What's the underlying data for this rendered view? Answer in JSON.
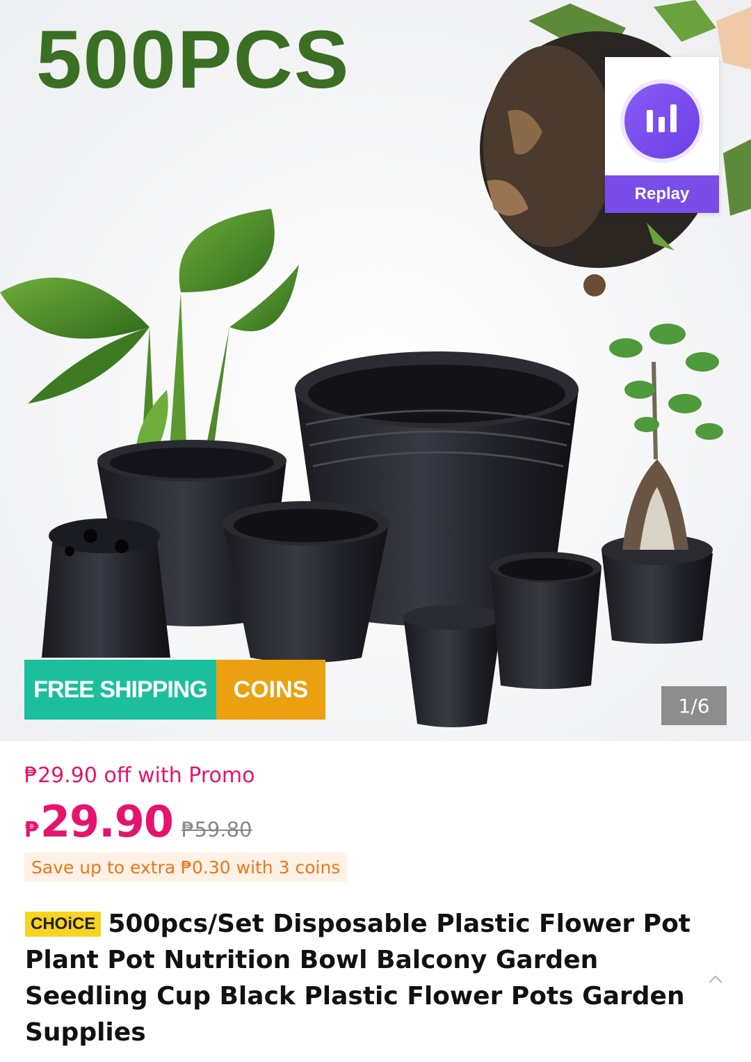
{
  "hero": {
    "overlay_text": "500PCS",
    "replay_label": "Replay",
    "free_shipping_label": "FREE SHIPPING",
    "coins_label": "COINS",
    "image_counter": "1/6",
    "colors": {
      "title_green": "#3a6f24",
      "replay_purple": "#7a4de8",
      "free_shipping_teal": "#1bbf9c",
      "coins_orange": "#eba00f"
    }
  },
  "pricing": {
    "promo_text": "₱29.90 off with Promo",
    "currency_symbol": "₱",
    "current_price": "29.90",
    "original_price": "₱59.80",
    "coins_offer": "Save up to extra ₱0.30 with 3 coins",
    "colors": {
      "price_pink": "#e5136d",
      "coins_text": "#e7771a"
    }
  },
  "product": {
    "badge": "CHOiCE",
    "title": "500pcs/Set Disposable Plastic Flower Pot Plant Pot Nutrition Bowl Balcony Garden Seedling Cup Black Plastic Flower Pots Garden Supplies"
  },
  "icons": {
    "replay": "bar-chart-icon",
    "scroll_top": "chevron-up-icon"
  }
}
